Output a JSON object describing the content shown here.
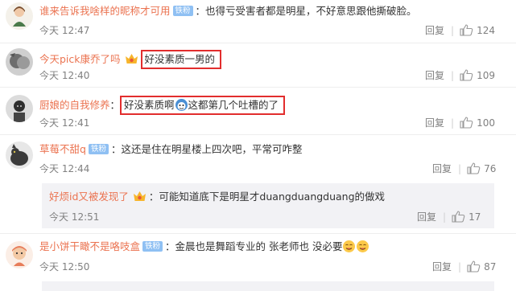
{
  "comments": [
    {
      "username": "谁来告诉我啥样的昵称才可用",
      "badge": "铁粉",
      "text": "：也得亏受害者都是明星，不好意思跟他撕破脸。",
      "time": "今天 12:47",
      "reply_label": "回复",
      "likes": "124"
    },
    {
      "username": "今天pick康乔了吗",
      "text": "好没素质一男的",
      "time": "今天 12:40",
      "reply_label": "回复",
      "likes": "109"
    },
    {
      "username": "厨娘的自我修养",
      "text_a": "好没素质啊",
      "text_b": "这都第几个吐槽的了",
      "time": "今天 12:41",
      "reply_label": "回复",
      "likes": "100"
    },
    {
      "username": "草莓不甜q",
      "badge": "铁粉",
      "text": "：这还是住在明星楼上四次吧，平常可咋整",
      "time": "今天 12:44",
      "reply_label": "回复",
      "likes": "76"
    },
    {
      "username": "好烦id又被发现了",
      "text": "：可能知道底下是明星才duangduangduang的做戏",
      "time": "今天 12:51",
      "reply_label": "回复",
      "likes": "17"
    },
    {
      "username": "是小饼干瞰不是咯吱盒",
      "badge": "铁粉",
      "text": "：金晨也是舞蹈专业的 张老师也 没必要",
      "time": "今天 12:50",
      "reply_label": "回复",
      "likes": "87"
    }
  ],
  "colors": {
    "username": "#eb7350",
    "highlight_box": "#e22d2d",
    "badge": "#8fc0f3",
    "reply_bg": "#f2f2f5"
  },
  "icons": [
    "crown-icon",
    "like-icon",
    "emoji-icon"
  ]
}
